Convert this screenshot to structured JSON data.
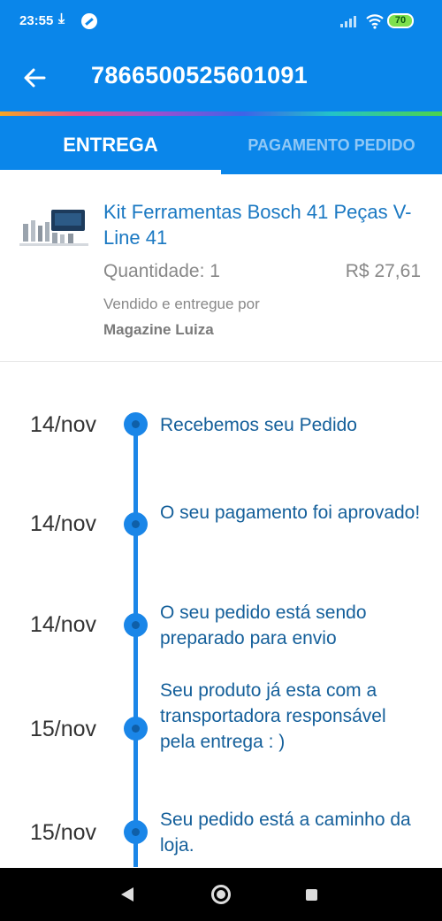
{
  "status_bar": {
    "time": "23:55",
    "battery": "70"
  },
  "header": {
    "order_id": "7866500525601091"
  },
  "tabs": [
    {
      "label": "ENTREGA",
      "active": true
    },
    {
      "label": "PAGAMENTO PEDIDO",
      "active": false
    }
  ],
  "product": {
    "title": "Kit Ferramentas Bosch 41 Peças V-Line 41",
    "quantity": "Quantidade: 1",
    "price": "R$ 27,61",
    "sold_by_label": "Vendido e entregue por",
    "seller": "Magazine Luiza"
  },
  "timeline": [
    {
      "date": "14/nov",
      "text": "Recebemos seu Pedido"
    },
    {
      "date": "14/nov",
      "text": "O seu pagamento foi aprovado!"
    },
    {
      "date": "14/nov",
      "text": "O seu pedido está sendo preparado para envio"
    },
    {
      "date": "15/nov",
      "text": "Seu produto já esta com a transportadora responsável pela entrega : )"
    },
    {
      "date": "15/nov",
      "text": "Seu pedido está a caminho da loja."
    }
  ],
  "colors": {
    "primary": "#0a86ea",
    "timeline": "#1a86e8",
    "link": "#1a78c2"
  }
}
